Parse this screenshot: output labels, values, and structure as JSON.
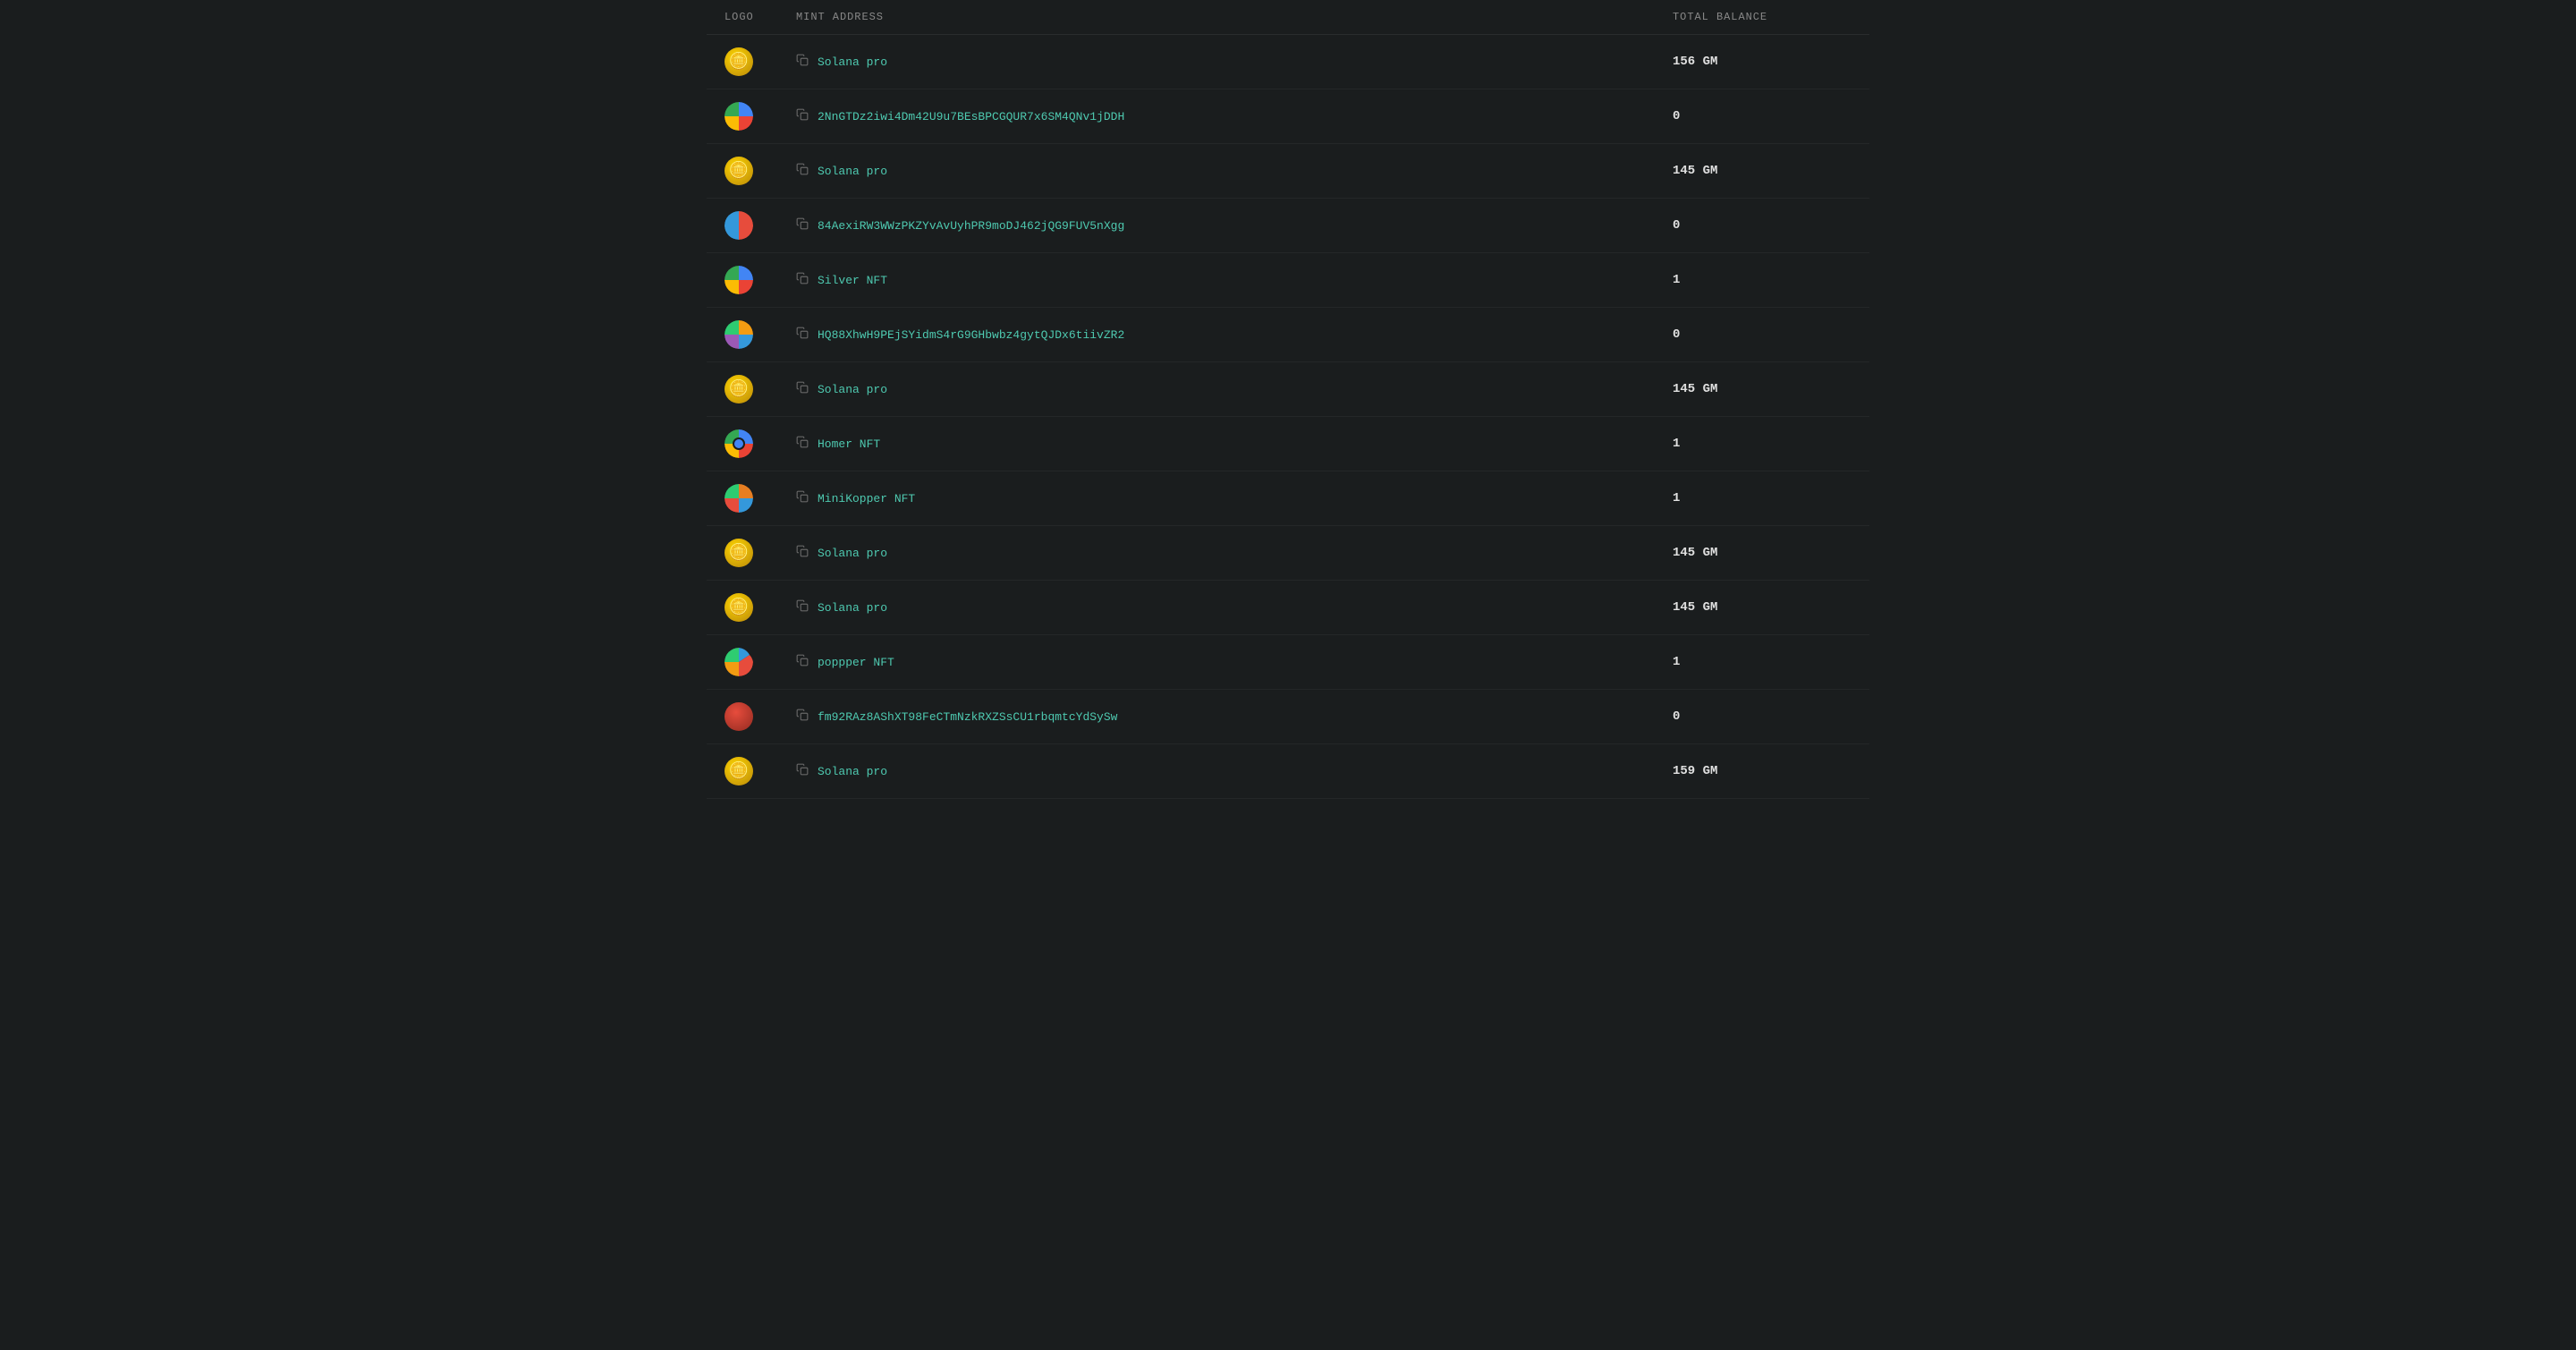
{
  "header": {
    "logo_col": "LOGO",
    "mint_col": "MINT ADDRESS",
    "balance_col": "TOTAL BALANCE"
  },
  "rows": [
    {
      "id": 1,
      "logo_type": "logo-gold",
      "logo_emoji": "🪙",
      "mint_name": "Solana pro",
      "is_name": true,
      "balance": "156 GM"
    },
    {
      "id": 2,
      "logo_type": "logo-multi-blue",
      "logo_emoji": "",
      "mint_name": "2NnGTDz2iwi4Dm42U9u7BEsBPCGQUR7x6SM4QNv1jDDH",
      "is_name": false,
      "balance": "0"
    },
    {
      "id": 3,
      "logo_type": "logo-gold",
      "logo_emoji": "🪙",
      "mint_name": "Solana pro",
      "is_name": true,
      "balance": "145 GM"
    },
    {
      "id": 4,
      "logo_type": "logo-pie",
      "logo_emoji": "",
      "mint_name": "84AexiRW3WWzPKZYvAvUyhPR9moDJ462jQG9FUV5nXgg",
      "is_name": false,
      "balance": "0"
    },
    {
      "id": 5,
      "logo_type": "logo-multi-blue",
      "logo_emoji": "",
      "mint_name": "Silver NFT",
      "is_name": true,
      "balance": "1"
    },
    {
      "id": 6,
      "logo_type": "logo-orange-blue",
      "logo_emoji": "",
      "mint_name": "HQ88XhwH9PEjSYidmS4rG9GHbwbz4gytQJDx6tiivZR2",
      "is_name": false,
      "balance": "0"
    },
    {
      "id": 7,
      "logo_type": "logo-gold",
      "logo_emoji": "🪙",
      "mint_name": "Solana pro",
      "is_name": true,
      "balance": "145 GM"
    },
    {
      "id": 8,
      "logo_type": "logo-chrome",
      "logo_emoji": "",
      "mint_name": "Homer NFT",
      "is_name": true,
      "balance": "1"
    },
    {
      "id": 9,
      "logo_type": "logo-copper",
      "logo_emoji": "",
      "mint_name": "MiniKopper NFT",
      "is_name": true,
      "balance": "1"
    },
    {
      "id": 10,
      "logo_type": "logo-gold",
      "logo_emoji": "🪙",
      "mint_name": "Solana pro",
      "is_name": true,
      "balance": "145 GM"
    },
    {
      "id": 11,
      "logo_type": "logo-gold",
      "logo_emoji": "🪙",
      "mint_name": "Solana pro",
      "is_name": true,
      "balance": "145 GM"
    },
    {
      "id": 12,
      "logo_type": "logo-colorful-7",
      "logo_emoji": "",
      "mint_name": "poppper NFT",
      "is_name": true,
      "balance": "1"
    },
    {
      "id": 13,
      "logo_type": "logo-red-circle",
      "logo_emoji": "",
      "mint_name": "fm92RAz8AShXT98FeCTmNzkRXZSsCU1rbqmtcYdSySw",
      "is_name": false,
      "balance": "0"
    },
    {
      "id": 14,
      "logo_type": "logo-gold",
      "logo_emoji": "🪙",
      "mint_name": "Solana pro",
      "is_name": true,
      "balance": "159 GM"
    }
  ]
}
